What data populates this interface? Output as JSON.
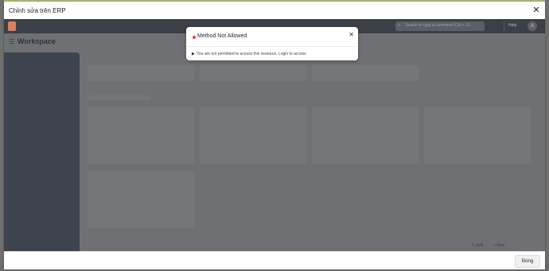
{
  "outer_modal": {
    "title": "Chỉnh sửa trên ERP",
    "close_icon": "✕"
  },
  "erp": {
    "search_placeholder": "Search or type a command (Ctrl + G)",
    "search_icon": "⌕",
    "help_label": "Help",
    "avatar_letter": "A",
    "menu_icon": "☰",
    "workspace_title": "Workspace",
    "footer_edit": "✎ Edit",
    "footer_new": "+ New"
  },
  "alert": {
    "title": "Method Not Allowed",
    "close_icon": "✕",
    "caret": "▶",
    "message": "You are not permitted to access this resource. Login to access"
  },
  "footer": {
    "close_label": "Đóng"
  }
}
